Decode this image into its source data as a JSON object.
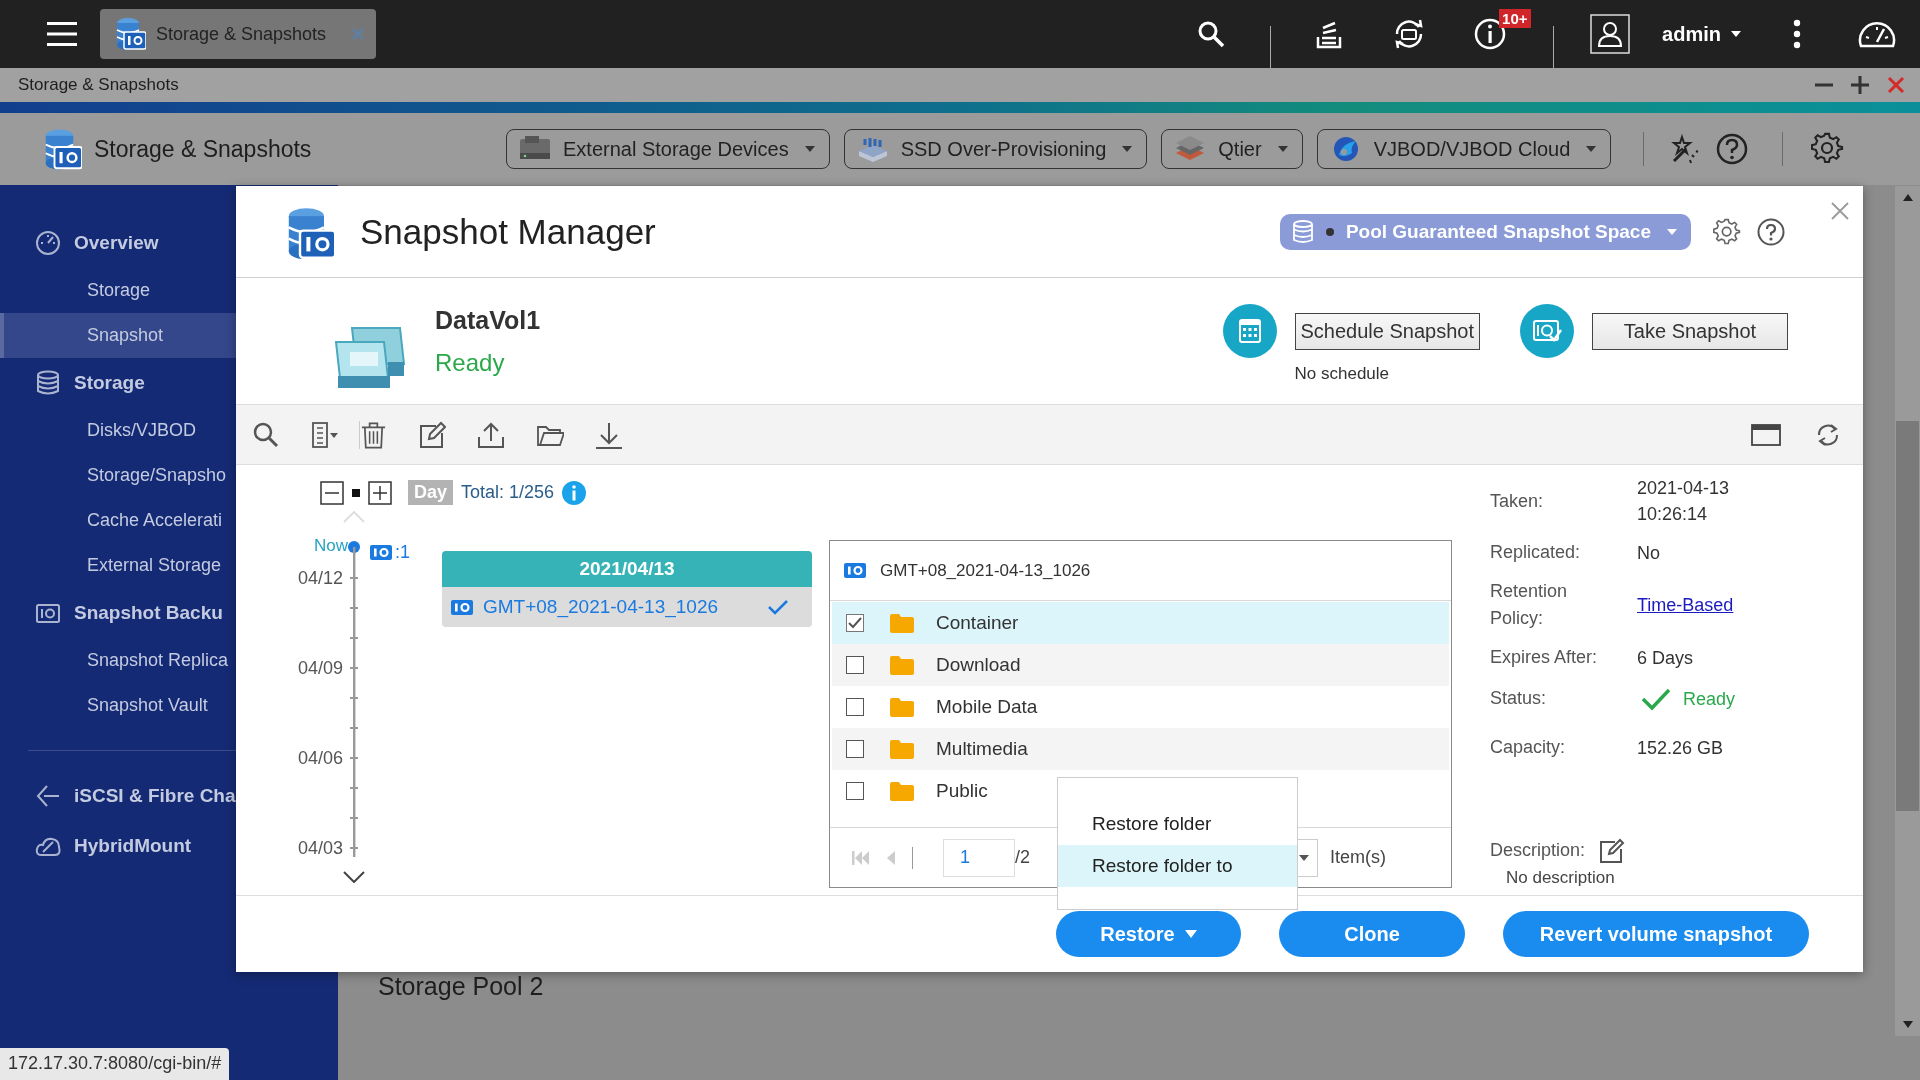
{
  "top_bar": {
    "tab": {
      "title": "Storage & Snapshots"
    },
    "notification_badge": "10+",
    "user": "admin"
  },
  "window": {
    "title": "Storage & Snapshots"
  },
  "app_header": {
    "title": "Storage & Snapshots",
    "menus": [
      "External Storage Devices",
      "SSD Over-Provisioning",
      "Qtier",
      "VJBOD/VJBOD Cloud"
    ]
  },
  "sidebar": {
    "groups": [
      {
        "items": [
          {
            "label": "Overview",
            "children": [
              {
                "label": "Storage",
                "selected": false
              },
              {
                "label": "Snapshot",
                "selected": true
              }
            ]
          },
          {
            "label": "Storage",
            "children": [
              {
                "label": "Disks/VJBOD",
                "selected": false
              },
              {
                "label": "Storage/Snapsho",
                "selected": false
              },
              {
                "label": "Cache Accelerati",
                "selected": false
              },
              {
                "label": "External Storage",
                "selected": false
              }
            ]
          },
          {
            "label": "Snapshot Backu",
            "children": [
              {
                "label": "Snapshot Replica",
                "selected": false
              },
              {
                "label": "Snapshot Vault",
                "selected": false
              }
            ]
          }
        ]
      },
      {
        "items": [
          {
            "label": "iSCSI & Fibre Cha"
          },
          {
            "label": "HybridMount"
          }
        ]
      }
    ]
  },
  "content": {
    "heading": "Storage Pool 2"
  },
  "dialog": {
    "title": "Snapshot Manager",
    "space_menu": "Pool Guaranteed Snapshot Space",
    "volume": {
      "name": "DataVol1",
      "status": "Ready"
    },
    "schedule_button": "Schedule Snapshot",
    "schedule_note": "No schedule",
    "take_button": "Take Snapshot",
    "timeline": {
      "unit": "Day",
      "total": "Total: 1/256",
      "now": "Now",
      "count": ":1",
      "dates": [
        "04/12",
        "04/09",
        "04/06",
        "04/03"
      ],
      "group": {
        "date": "2021/04/13",
        "snapshots": [
          {
            "name": "GMT+08_2021-04-13_1026",
            "selected": true
          }
        ]
      }
    },
    "file_list": {
      "snapshot": "GMT+08_2021-04-13_1026",
      "folders": [
        {
          "name": "Container",
          "checked": true
        },
        {
          "name": "Download",
          "checked": false
        },
        {
          "name": "Mobile Data",
          "checked": false
        },
        {
          "name": "Multimedia",
          "checked": false
        },
        {
          "name": "Public",
          "checked": false
        }
      ],
      "page": "1",
      "pages": "/2",
      "per_page_label": "Item(s)"
    },
    "details": [
      {
        "label": "Taken:",
        "value": "2021-04-13\n10:26:14",
        "kind": "text"
      },
      {
        "label": "Replicated:",
        "value": "No",
        "kind": "text"
      },
      {
        "label": "Retention\nPolicy:",
        "value": "Time-Based",
        "kind": "link"
      },
      {
        "label": "Expires After:",
        "value": "6 Days",
        "kind": "text"
      },
      {
        "label": "Status:",
        "value": "Ready",
        "kind": "status"
      },
      {
        "label": "Capacity:",
        "value": "152.26 GB",
        "kind": "text"
      },
      {
        "label": "Description:",
        "value": "No description",
        "kind": "description"
      }
    ],
    "actions": [
      {
        "label": "Restore",
        "kind": "dropdown"
      },
      {
        "label": "Clone",
        "kind": "plain"
      },
      {
        "label": "Revert volume snapshot",
        "kind": "plain"
      }
    ],
    "restore_menu": [
      {
        "label": "Restore folder",
        "selected": false
      },
      {
        "label": "Restore folder to",
        "selected": true
      }
    ]
  },
  "status_url": "172.17.30.7:8080/cgi-bin/#"
}
